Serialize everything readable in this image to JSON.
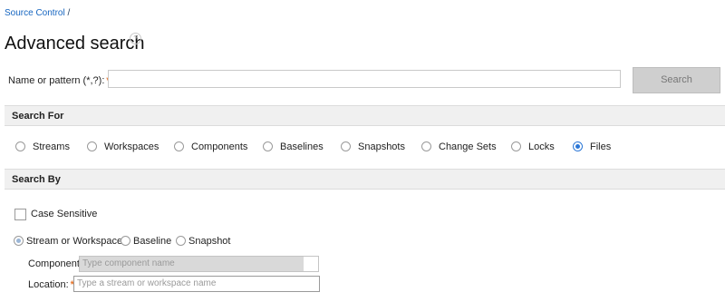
{
  "breadcrumb": {
    "link": "Source Control",
    "separator": " /"
  },
  "title": "Advanced search",
  "help_icon": "question-mark-icon",
  "name_field": {
    "label": "Name or pattern (*,?):",
    "required_marker": "*",
    "value": ""
  },
  "search_button": "Search",
  "search_for": {
    "header": "Search For",
    "options": [
      {
        "label": "Streams",
        "selected": false
      },
      {
        "label": "Workspaces",
        "selected": false
      },
      {
        "label": "Components",
        "selected": false
      },
      {
        "label": "Baselines",
        "selected": false
      },
      {
        "label": "Snapshots",
        "selected": false
      },
      {
        "label": "Change Sets",
        "selected": false
      },
      {
        "label": "Locks",
        "selected": false
      },
      {
        "label": "Files",
        "selected": true
      }
    ]
  },
  "search_by": {
    "header": "Search By",
    "case_sensitive": {
      "label": "Case Sensitive",
      "checked": false
    },
    "scope_options": [
      {
        "label": "Stream or Workspace",
        "selected": true
      },
      {
        "label": "Baseline",
        "selected": false
      },
      {
        "label": "Snapshot",
        "selected": false
      }
    ],
    "component": {
      "label": "Component:",
      "placeholder": "Type component name"
    },
    "location": {
      "label": "Location:",
      "required_marker": "*",
      "placeholder": "Type a stream or workspace name"
    }
  },
  "colors": {
    "link": "#1565c0",
    "accent": "#2b77d6",
    "required": "#e8742a",
    "section_bg": "#f0f0f0"
  }
}
